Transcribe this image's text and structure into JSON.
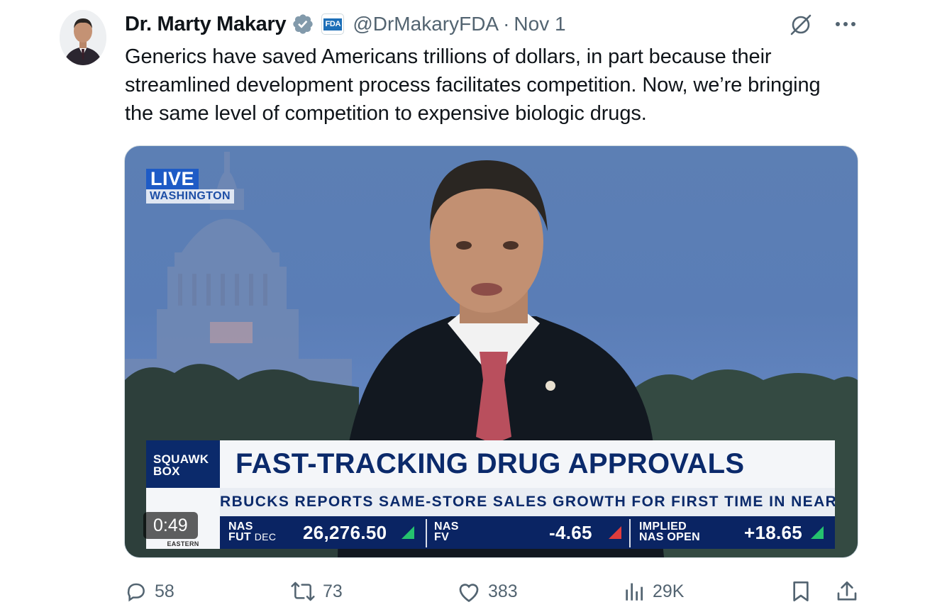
{
  "tweet": {
    "author_name": "Dr. Marty Makary",
    "org_badge_text": "FDA",
    "handle": "@DrMakaryFDA",
    "separator": "·",
    "date": "Nov 1",
    "text": "Generics have saved Americans trillions of dollars, in part because their streamlined development process facilitates competition. Now, we’re bringing the same level of competition to expensive biologic drugs."
  },
  "video": {
    "live_label": "LIVE",
    "location": "WASHINGTON",
    "show_name_line1": "SQUAWK",
    "show_name_line2": "BOX",
    "headline": "FAST-TRACKING DRUG APPROVALS",
    "ticker_text": "RBUCKS REPORTS SAME-STORE SALES GROWTH FOR FIRST TIME IN NEARLY",
    "network_sub": "EASTERN",
    "duration": "0:49",
    "markets": [
      {
        "line1": "NAS",
        "line2": "FUT",
        "line2_small": "DEC",
        "value": "26,276.50",
        "direction": "up"
      },
      {
        "line1": "NAS",
        "line2": "FV",
        "line2_small": "",
        "value": "-4.65",
        "direction": "down"
      },
      {
        "line1": "IMPLIED",
        "line2": "NAS OPEN",
        "line2_small": "",
        "value": "+18.65",
        "direction": "up"
      }
    ]
  },
  "actions": {
    "replies": "58",
    "reposts": "73",
    "likes": "383",
    "views": "29K"
  },
  "icons": [
    "avatar",
    "verified-check-icon",
    "org-badge-icon",
    "grok-icon",
    "more-icon",
    "reply-icon",
    "repost-icon",
    "like-icon",
    "views-icon",
    "bookmark-icon",
    "share-icon"
  ],
  "colors": {
    "text": "#0f1419",
    "secondary": "#536471",
    "verified": "#829aab",
    "cnbc_navy": "#0a2463",
    "live_blue": "#1e5bc6"
  }
}
